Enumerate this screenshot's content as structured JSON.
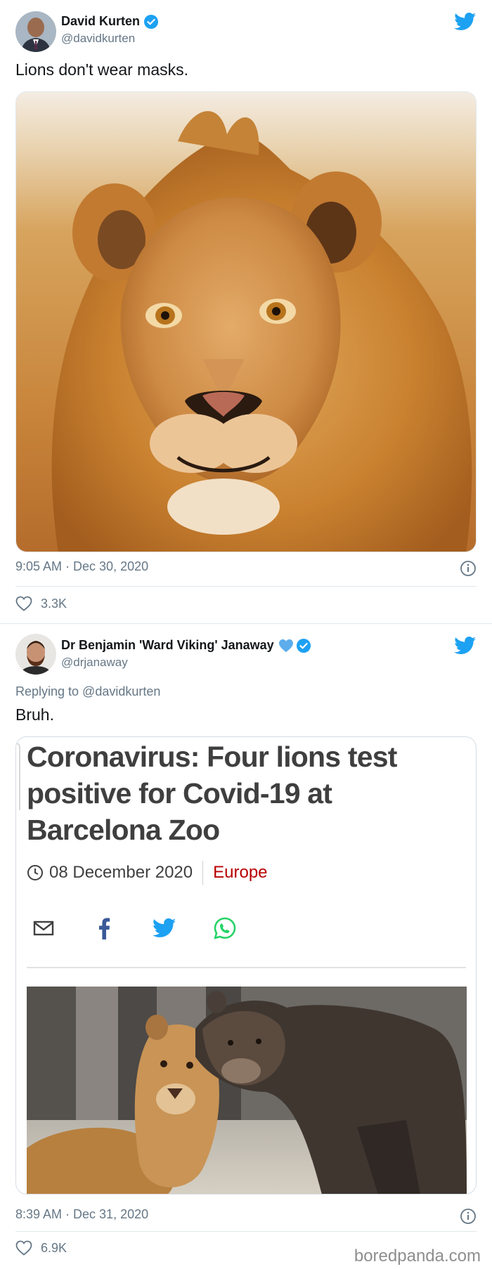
{
  "tweets": [
    {
      "author_name": "David Kurten",
      "handle": "@davidkurten",
      "text": "Lions don't wear masks.",
      "timestamp": "9:05 AM · Dec 30, 2020",
      "likes": "3.3K",
      "media_description": "Close-up photo of a male lion"
    },
    {
      "author_name": "Dr Benjamin 'Ward Viking' Janaway",
      "handle": "@drjanaway",
      "replying_to": "Replying to @davidkurten",
      "text": "Bruh.",
      "timestamp": "8:39 AM · Dec 31, 2020",
      "likes": "6.9K",
      "card": {
        "headline": "Coronavirus: Four lions test positive for Covid-19 at Barcelona Zoo",
        "date": "08 December 2020",
        "section": "Europe",
        "share_icons": [
          "email-icon",
          "facebook-icon",
          "twitter-icon",
          "whatsapp-icon"
        ]
      }
    }
  ],
  "watermark": "boredpanda.com",
  "colors": {
    "twitter_blue": "#1da1f2",
    "text_primary": "#14171a",
    "text_secondary": "#657786",
    "divider": "#e1e8ed",
    "section_red": "#b80000",
    "facebook_blue": "#3b5998",
    "whatsapp_green": "#25d366"
  }
}
